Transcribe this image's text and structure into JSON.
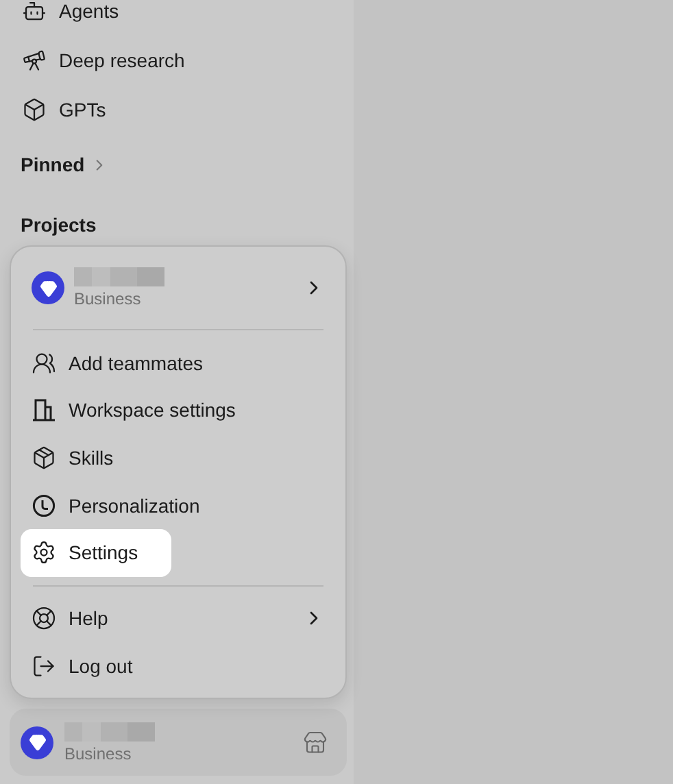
{
  "nav": [
    {
      "label": "Agents"
    },
    {
      "label": "Deep research"
    },
    {
      "label": "GPTs"
    }
  ],
  "sections": [
    {
      "label": "Pinned",
      "expandable": true
    },
    {
      "label": "Projects",
      "expandable": false
    }
  ],
  "account_menu": {
    "account": {
      "plan": "Business",
      "submenu": true
    },
    "groups": [
      [
        {
          "label": "Add teammates",
          "selected": false,
          "submenu": false
        },
        {
          "label": "Workspace settings",
          "selected": false,
          "submenu": false
        },
        {
          "label": "Skills",
          "selected": false,
          "submenu": false
        },
        {
          "label": "Personalization",
          "selected": false,
          "submenu": false
        },
        {
          "label": "Settings",
          "selected": true,
          "submenu": false
        }
      ],
      [
        {
          "label": "Help",
          "selected": false,
          "submenu": true
        },
        {
          "label": "Log out",
          "selected": false,
          "submenu": false
        }
      ]
    ]
  },
  "profile": {
    "plan": "Business"
  }
}
